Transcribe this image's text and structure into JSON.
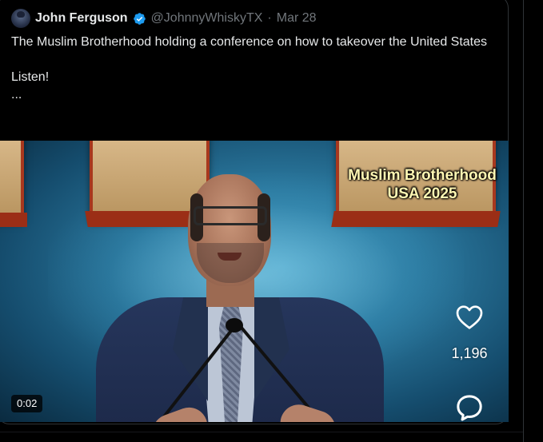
{
  "tweet": {
    "display_name": "John Ferguson",
    "handle": "@JohnnyWhiskyTX",
    "separator": "·",
    "date": "Mar 28",
    "verified": true,
    "text_line_1": "The Muslim Brotherhood holding a conference on how to takeover the United States",
    "text_line_2": "Listen!",
    "text_line_3": "..."
  },
  "media": {
    "overlay_title_line_1": "Muslim Brotherhood",
    "overlay_title_line_2": "USA 2025",
    "duration": "0:02",
    "like_count": "1,196",
    "like_icon": "heart-icon",
    "comment_icon": "speech-bubble-icon"
  },
  "colors": {
    "text_primary": "#e7e9ea",
    "text_secondary": "#71767b",
    "verified_blue": "#1d9bf0",
    "overlay_title": "#fff7b3",
    "border": "#2f3336"
  }
}
